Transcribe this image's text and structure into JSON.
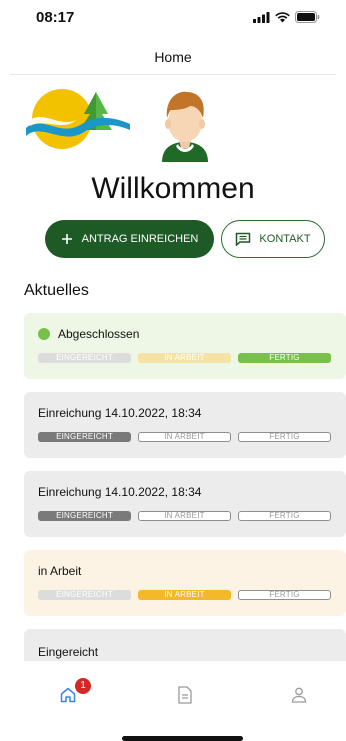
{
  "status_bar": {
    "time": "08:17"
  },
  "nav": {
    "title": "Home"
  },
  "hero": {
    "welcome": "Willkommen"
  },
  "actions": {
    "primary_label": "ANTRAG EINREICHEN",
    "secondary_label": "KONTAKT"
  },
  "section": {
    "title": "Aktuelles"
  },
  "steps_labels": [
    "EINGEREICHT",
    "IN ARBEIT",
    "FERTIG"
  ],
  "cards": [
    {
      "title": "Abgeschlossen",
      "state": "fertig",
      "background": "#eef7e6"
    },
    {
      "title": "Einreichung 14.10.2022, 18:34",
      "state": "eingereicht",
      "background": "#ececec"
    },
    {
      "title": "Einreichung 14.10.2022, 18:34",
      "state": "eingereicht",
      "background": "#ececec"
    },
    {
      "title": "in Arbeit",
      "state": "in_arbeit",
      "background": "#fcf3e4"
    },
    {
      "title": "Eingereicht",
      "state": "eingereicht",
      "background": "#ececec"
    }
  ],
  "tabbar": {
    "home_badge": "1",
    "items": [
      "home-icon",
      "document-icon",
      "profile-icon"
    ]
  },
  "colors": {
    "brand_green": "#1e5a25",
    "accent_green": "#79bf4b",
    "accent_yellow": "#f4b929",
    "tab_active": "#3b82f6",
    "badge_red": "#d62626"
  }
}
